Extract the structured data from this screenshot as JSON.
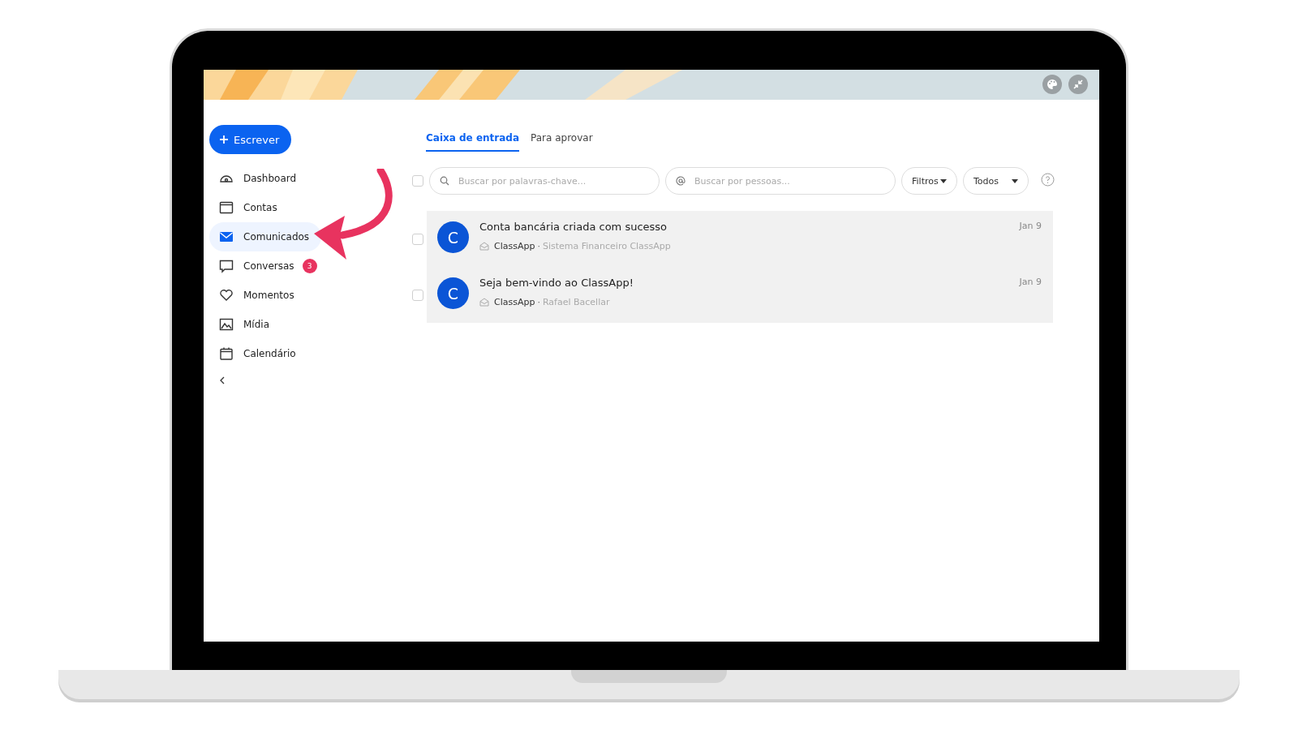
{
  "compose_button": {
    "label": "Escrever"
  },
  "nav": [
    {
      "kind": "dashboard",
      "label": "Dashboard",
      "selected": false
    },
    {
      "kind": "accounts",
      "label": "Contas",
      "selected": false
    },
    {
      "kind": "messages",
      "label": "Comunicados",
      "selected": true
    },
    {
      "kind": "chat",
      "label": "Conversas",
      "selected": false,
      "badge": "3"
    },
    {
      "kind": "moments",
      "label": "Momentos",
      "selected": false
    },
    {
      "kind": "media",
      "label": "Mídia",
      "selected": false
    },
    {
      "kind": "calendar",
      "label": "Calendário",
      "selected": false
    }
  ],
  "tabs": [
    {
      "label": "Caixa de entrada",
      "selected": true
    },
    {
      "label": "Para aprovar",
      "selected": false
    }
  ],
  "select_all": {
    "checked": false
  },
  "keyword_search": {
    "placeholder": "Buscar por palavras-chave..."
  },
  "people_search": {
    "placeholder": "Buscar por pessoas..."
  },
  "dropdowns": [
    {
      "label": "Filtros"
    },
    {
      "label": "Todos"
    }
  ],
  "messages": [
    {
      "checked": false,
      "avatar": "C",
      "title": "Conta bancária criada com sucesso",
      "sender": "ClassApp",
      "separator": "·",
      "source": "Sistema Financeiro ClassApp",
      "date": "Jan 9"
    },
    {
      "checked": false,
      "avatar": "C",
      "title": "Seja bem-vindo ao ClassApp!",
      "sender": "ClassApp",
      "separator": "·",
      "source": "Rafael Bacellar",
      "date": "Jan 9"
    }
  ]
}
